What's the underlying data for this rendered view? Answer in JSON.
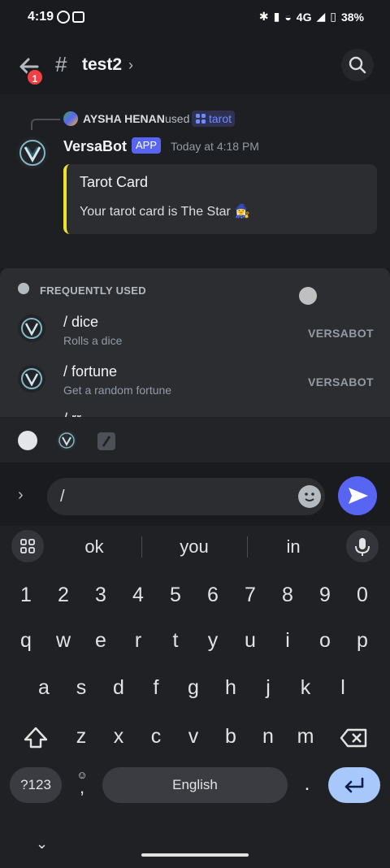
{
  "status_bar": {
    "time": "4:19",
    "battery": "38%",
    "network": "4G"
  },
  "header": {
    "badge_count": "1",
    "hash": "#",
    "channel": "test2",
    "chevron": "›"
  },
  "message": {
    "used_by": "AYSHA HENAN",
    "used_word": "used",
    "command": "tarot",
    "bot_name": "VersaBot",
    "bot_tag": "APP",
    "timestamp": "Today at 4:18 PM",
    "embed_title": "Tarot Card",
    "embed_desc": "Your tarot card is The Star 🧙‍♀️",
    "embed_color": "#f0e130"
  },
  "suggestions": {
    "section_label": "FREQUENTLY USED",
    "commands": [
      {
        "name": "/ dice",
        "desc": "Rolls a dice",
        "source": "VERSABOT"
      },
      {
        "name": "/ fortune",
        "desc": "Get a random fortune",
        "source": "VERSABOT"
      },
      {
        "name": "/ rr",
        "desc": "",
        "source": ""
      }
    ]
  },
  "composer": {
    "value": "/",
    "expand": "›"
  },
  "keyboard": {
    "suggestions": [
      "ok",
      "you",
      "in"
    ],
    "row_numbers": [
      "1",
      "2",
      "3",
      "4",
      "5",
      "6",
      "7",
      "8",
      "9",
      "0"
    ],
    "row1": [
      "q",
      "w",
      "e",
      "r",
      "t",
      "y",
      "u",
      "i",
      "o",
      "p"
    ],
    "row2": [
      "a",
      "s",
      "d",
      "f",
      "g",
      "h",
      "j",
      "k",
      "l"
    ],
    "row3": [
      "z",
      "x",
      "c",
      "v",
      "b",
      "n",
      "m"
    ],
    "sym_label": "?123",
    "comma": ",",
    "space_label": "English",
    "period": "."
  },
  "colors": {
    "accent": "#5865f2",
    "badge": "#f23f43"
  }
}
